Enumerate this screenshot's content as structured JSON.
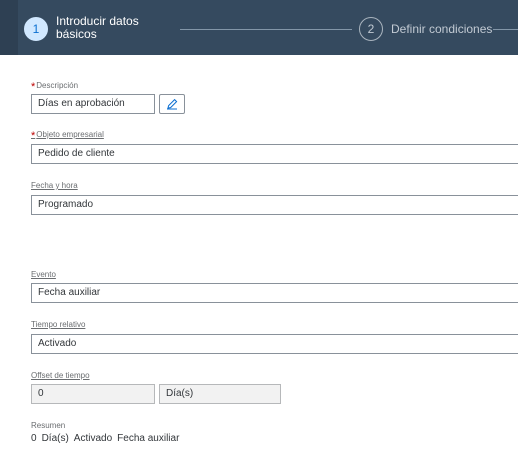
{
  "wizard": {
    "step1": {
      "number": "1",
      "title": "Introducir datos básicos"
    },
    "step2": {
      "number": "2",
      "title": "Definir condiciones"
    }
  },
  "form": {
    "descripcion": {
      "label": "Descripción",
      "value": "Días en aprobación",
      "required": true
    },
    "objeto": {
      "label": "Objeto empresarial",
      "value": "Pedido de cliente",
      "required": true
    },
    "fecha_hora": {
      "label": "Fecha y hora",
      "value": "Programado"
    },
    "evento": {
      "label": "Evento",
      "value": "Fecha auxiliar"
    },
    "tiempo_relativo": {
      "label": "Tiempo relativo",
      "value": "Activado"
    },
    "offset": {
      "label": "Offset de tiempo",
      "value": "0",
      "unit": "Día(s)"
    }
  },
  "summary": {
    "label": "Resumen",
    "offset": "0",
    "unit": "Día(s)",
    "relative": "Activado",
    "event": "Fecha auxiliar"
  },
  "icons": {
    "edit": "edit-pencil-icon"
  },
  "colors": {
    "header_bg": "#354a5f",
    "active_step": "#d1e8ff",
    "required": "#bb0000"
  }
}
